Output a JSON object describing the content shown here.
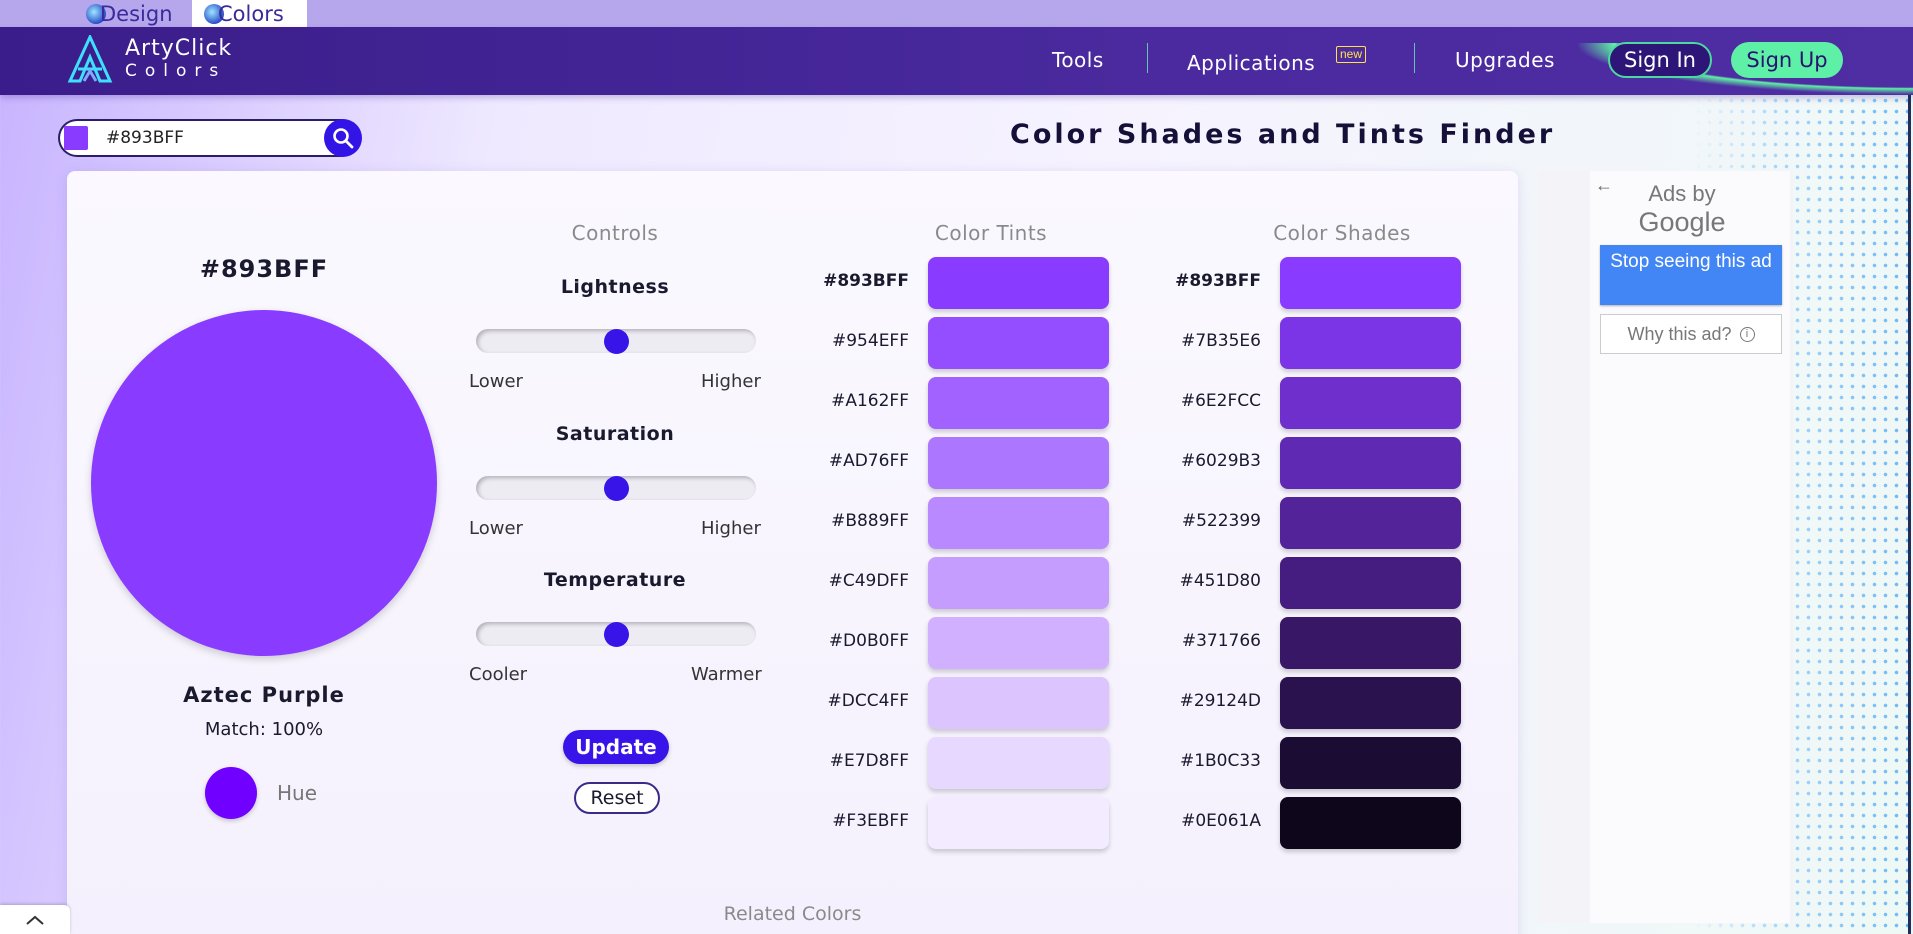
{
  "top_tabs": [
    {
      "label": "Design"
    },
    {
      "label": "Colors"
    }
  ],
  "brand": {
    "line1": "ArtyClick",
    "line2": "Colors"
  },
  "nav": {
    "tools": "Tools",
    "applications": "Applications",
    "new_badge": "new",
    "upgrades": "Upgrades",
    "sign_in": "Sign In",
    "sign_up": "Sign Up"
  },
  "search": {
    "value": "#893BFF",
    "swatch_color": "#893BFF"
  },
  "page_title": "Color Shades and Tints Finder",
  "selected": {
    "hex": "#893BFF",
    "name": "Aztec Purple",
    "match": "Match: 100%",
    "hue_label": "Hue",
    "hue_color": "#7000FF"
  },
  "controls": {
    "title": "Controls",
    "sliders": [
      {
        "label": "Lightness",
        "low": "Lower",
        "high": "Higher",
        "value": 0.5
      },
      {
        "label": "Saturation",
        "low": "Lower",
        "high": "Higher",
        "value": 0.5
      },
      {
        "label": "Temperature",
        "low": "Cooler",
        "high": "Warmer",
        "value": 0.5
      }
    ],
    "update": "Update",
    "reset": "Reset"
  },
  "tints": {
    "title": "Color Tints",
    "items": [
      "#893BFF",
      "#954EFF",
      "#A162FF",
      "#AD76FF",
      "#B889FF",
      "#C49DFF",
      "#D0B0FF",
      "#DCC4FF",
      "#E7D8FF",
      "#F3EBFF"
    ]
  },
  "shades": {
    "title": "Color Shades",
    "items": [
      "#893BFF",
      "#7B35E6",
      "#6E2FCC",
      "#6029B3",
      "#522399",
      "#451D80",
      "#371766",
      "#29124D",
      "#1B0C33",
      "#0E061A"
    ]
  },
  "related": "Related Colors",
  "ad": {
    "ads_by": "Ads by",
    "google": "Google",
    "stop": "Stop seeing this ad",
    "why": "Why this ad?",
    "info_glyph": "i"
  }
}
